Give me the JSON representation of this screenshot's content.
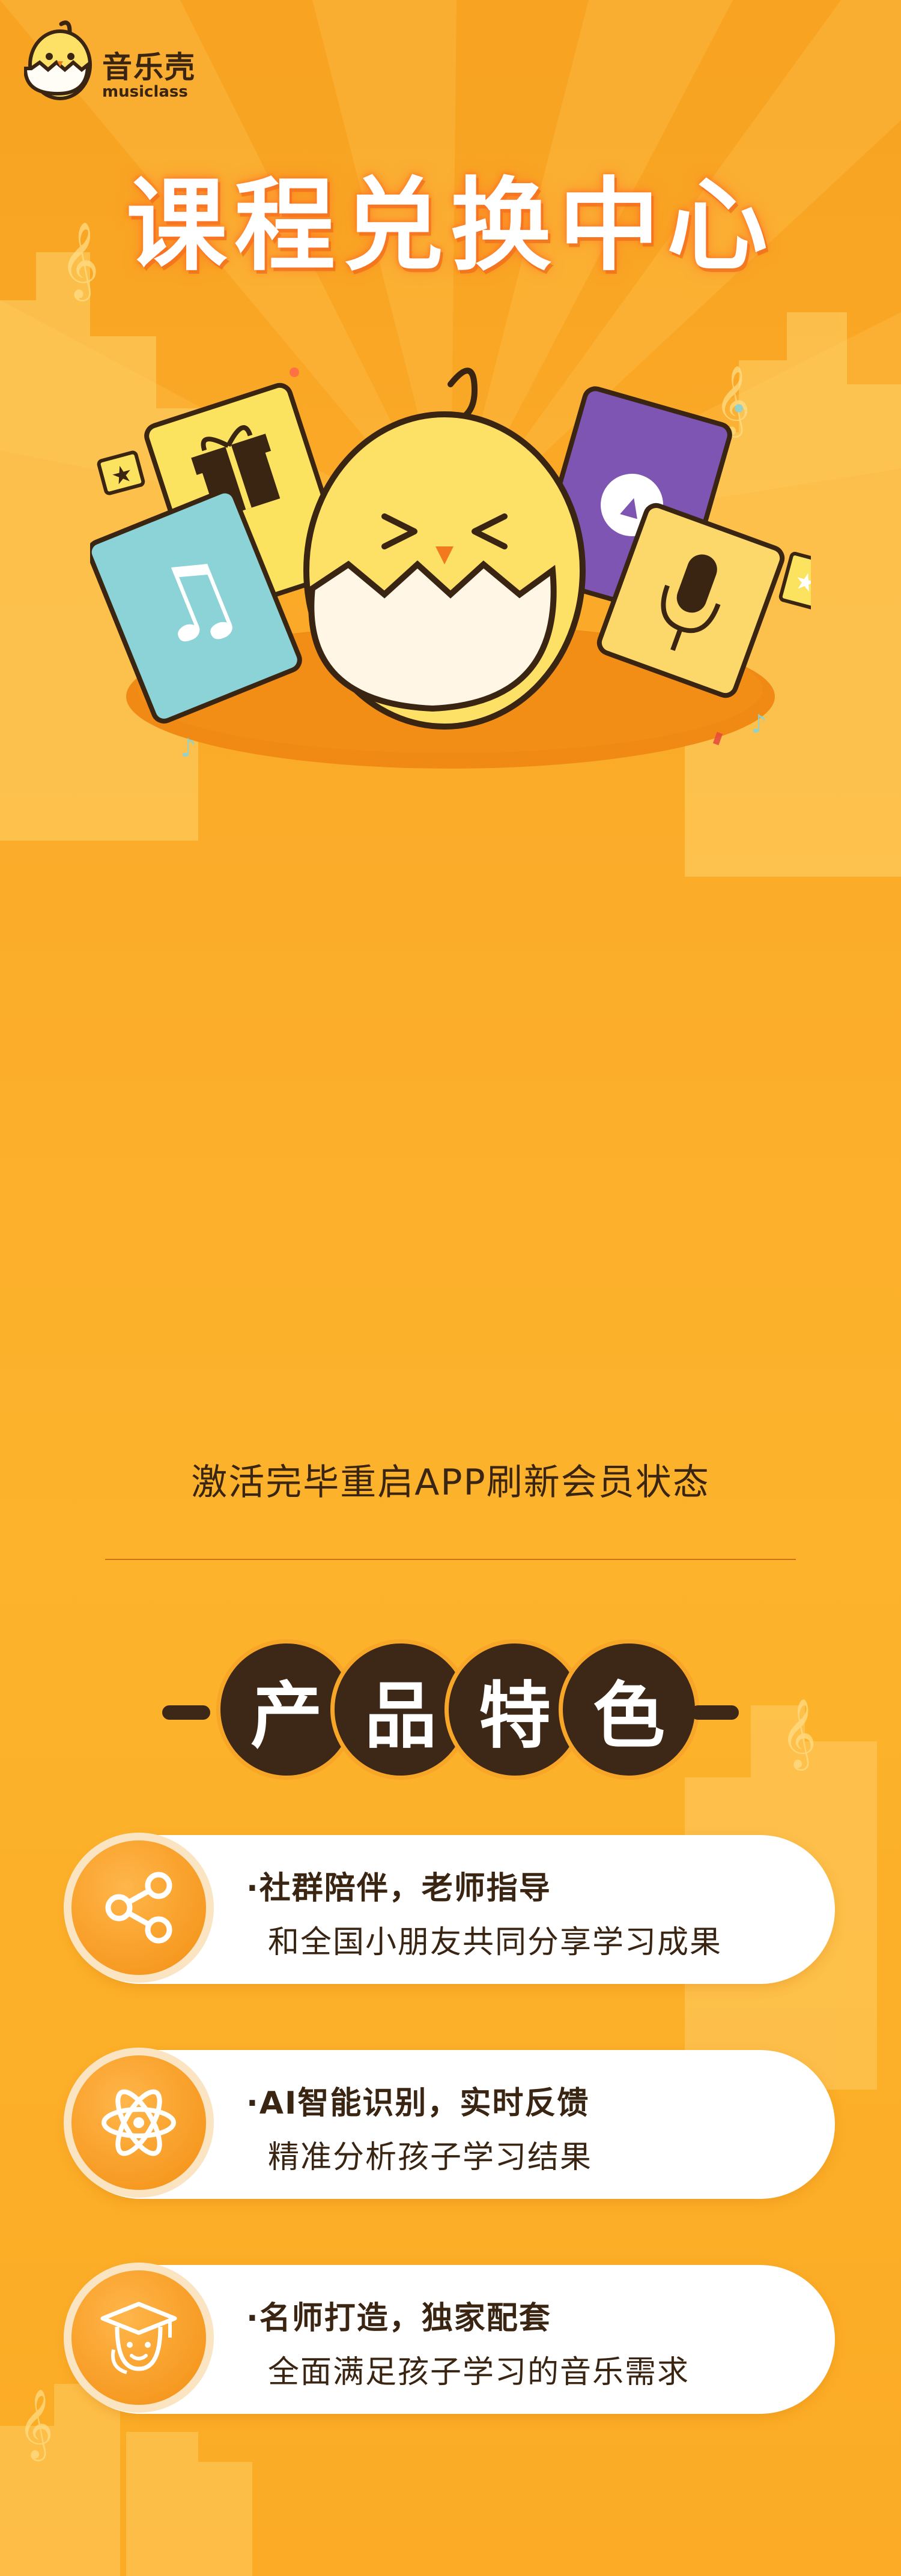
{
  "logo": {
    "brand_cn": "音乐壳",
    "brand_en": "musiclass"
  },
  "hero": {
    "title": "课程兑换中心"
  },
  "notice": {
    "text": "激活完毕重启APP刷新会员状态"
  },
  "features_section": {
    "title_chars": [
      "产",
      "品",
      "特",
      "色"
    ],
    "items": [
      {
        "title": "·社群陪伴，老师指导",
        "desc": "和全国小朋友共同分享学习成果",
        "icon": "share-icon"
      },
      {
        "title": "·AI智能识别，实时反馈",
        "desc": "精准分析孩子学习结果",
        "icon": "atom-icon"
      },
      {
        "title": "·名师打造，独家配套",
        "desc": "全面满足孩子学习的音乐需求",
        "icon": "teacher-icon"
      }
    ]
  },
  "colors": {
    "background": "#fbab25",
    "text_dark": "#3a2412",
    "accent_orange": "#f38f12",
    "card_bg": "#ffffff"
  }
}
